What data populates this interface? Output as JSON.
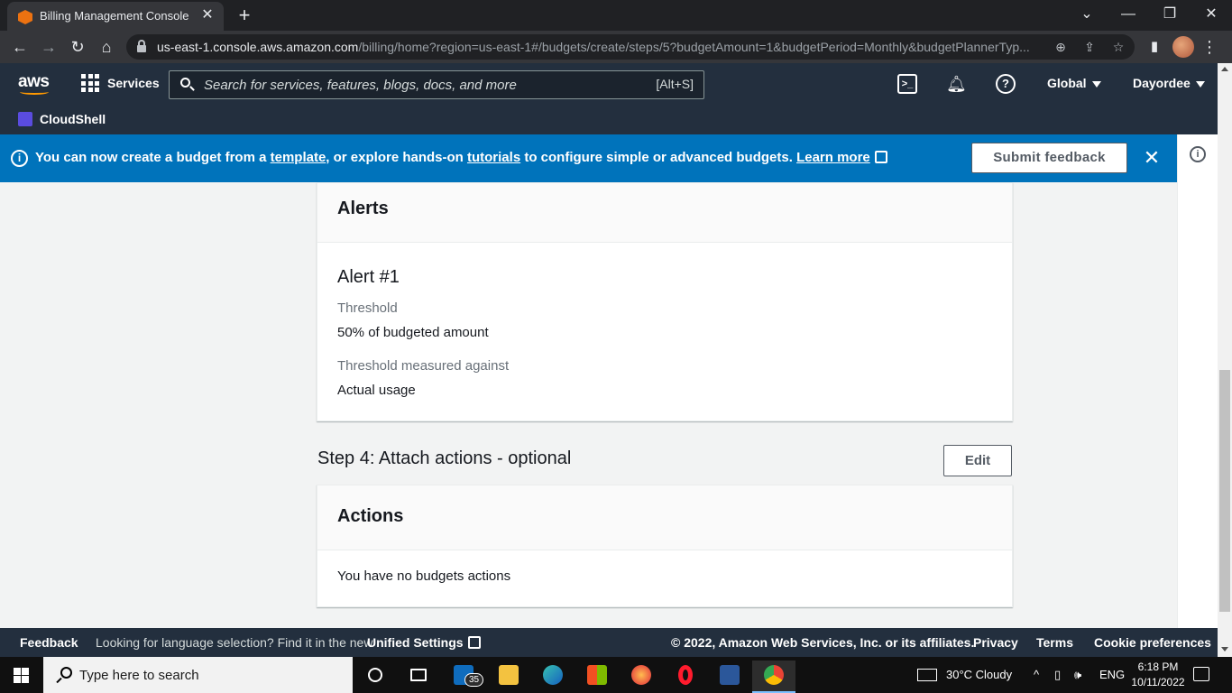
{
  "browser": {
    "tab_title": "Billing Management Console",
    "tab_close": "✕",
    "new_tab": "+",
    "url_host": "us-east-1.console.aws.amazon.com",
    "url_path": "/billing/home?region=us-east-1#/budgets/create/steps/5?budgetAmount=1&budgetPeriod=Monthly&budgetPlannerTyp...",
    "win_minimize": "—",
    "win_restore": "❐",
    "win_close": "✕",
    "win_dropdown": "⌄"
  },
  "aws_nav": {
    "logo": "aws",
    "services_label": "Services",
    "search_placeholder": "Search for services, features, blogs, docs, and more",
    "search_shortcut": "[Alt+S]",
    "region": "Global",
    "account": "Dayordee",
    "favorite_cloudshell": "CloudShell"
  },
  "flashbar": {
    "text_1": "You can now create a budget from a ",
    "link_template": "template",
    "text_2": ", or explore hands-on ",
    "link_tutorials": "tutorials",
    "text_3": " to configure simple or advanced budgets. ",
    "link_learn_more": "Learn more",
    "submit_feedback": "Submit feedback",
    "close": "✕"
  },
  "alerts_card": {
    "header": "Alerts",
    "alert_title": "Alert #1",
    "threshold_label": "Threshold",
    "threshold_value": "50% of budgeted amount",
    "measured_label": "Threshold measured against",
    "measured_value": "Actual usage"
  },
  "step4": {
    "title": "Step 4: Attach actions - optional",
    "edit_label": "Edit"
  },
  "actions_card": {
    "header": "Actions",
    "empty_text": "You have no budgets actions"
  },
  "footer": {
    "feedback": "Feedback",
    "lang_text": "Looking for language selection? Find it in the new ",
    "unified_settings": "Unified Settings",
    "copyright": "© 2022, Amazon Web Services, Inc. or its affiliates.",
    "privacy": "Privacy",
    "terms": "Terms",
    "cookie_preferences": "Cookie preferences"
  },
  "taskbar": {
    "search_placeholder": "Type here to search",
    "mail_badge": "35",
    "weather": "30°C  Cloudy",
    "language": "ENG",
    "time": "6:18 PM",
    "date": "10/11/2022"
  },
  "colors": {
    "aws_nav_bg": "#232f3e",
    "flash_bg": "#0073bb",
    "aws_orange": "#ff9900"
  }
}
